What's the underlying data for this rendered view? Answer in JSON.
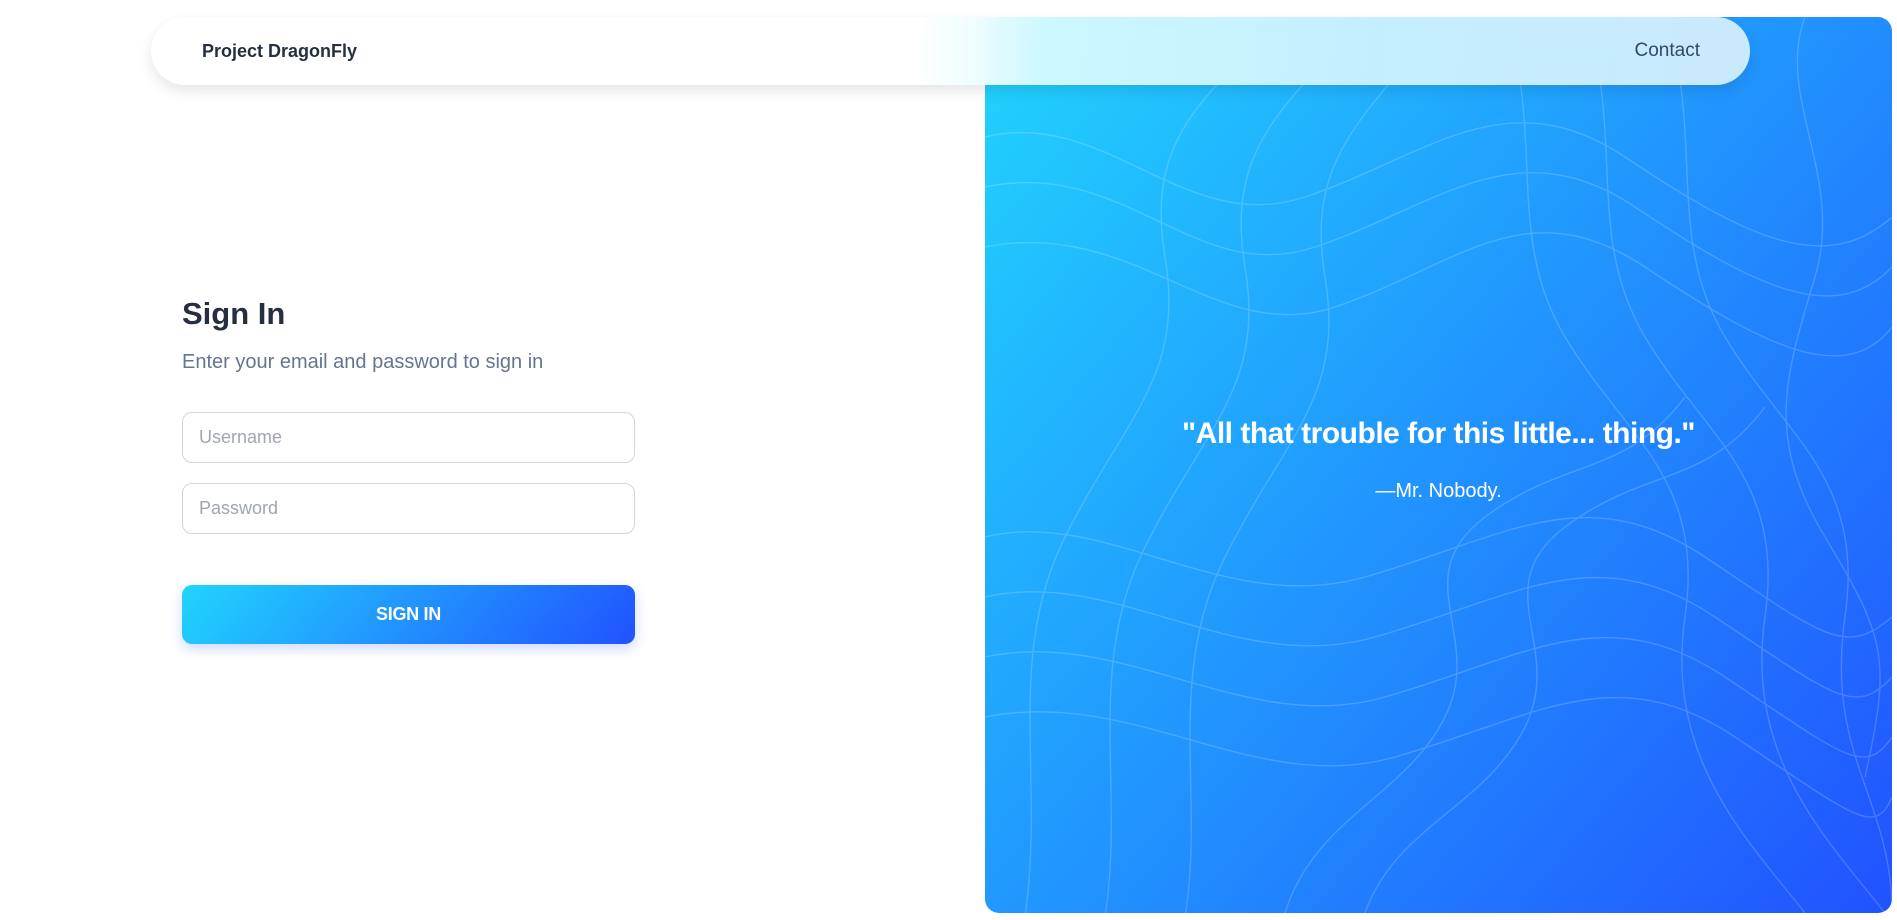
{
  "navbar": {
    "brand": "Project DragonFly",
    "contact_label": "Contact"
  },
  "signin": {
    "title": "Sign In",
    "subtitle": "Enter your email and password to sign in",
    "username_placeholder": "Username",
    "username_value": "",
    "password_placeholder": "Password",
    "password_value": "",
    "button_label": "SIGN IN"
  },
  "hero": {
    "quote": "\"All that trouble for this little... thing.\"",
    "author": "—Mr. Nobody."
  },
  "colors": {
    "gradient_start": "#21d4fd",
    "gradient_end": "#2152ff",
    "heading": "#252f40",
    "muted_text": "#67748e",
    "input_border": "#d2d6da"
  }
}
